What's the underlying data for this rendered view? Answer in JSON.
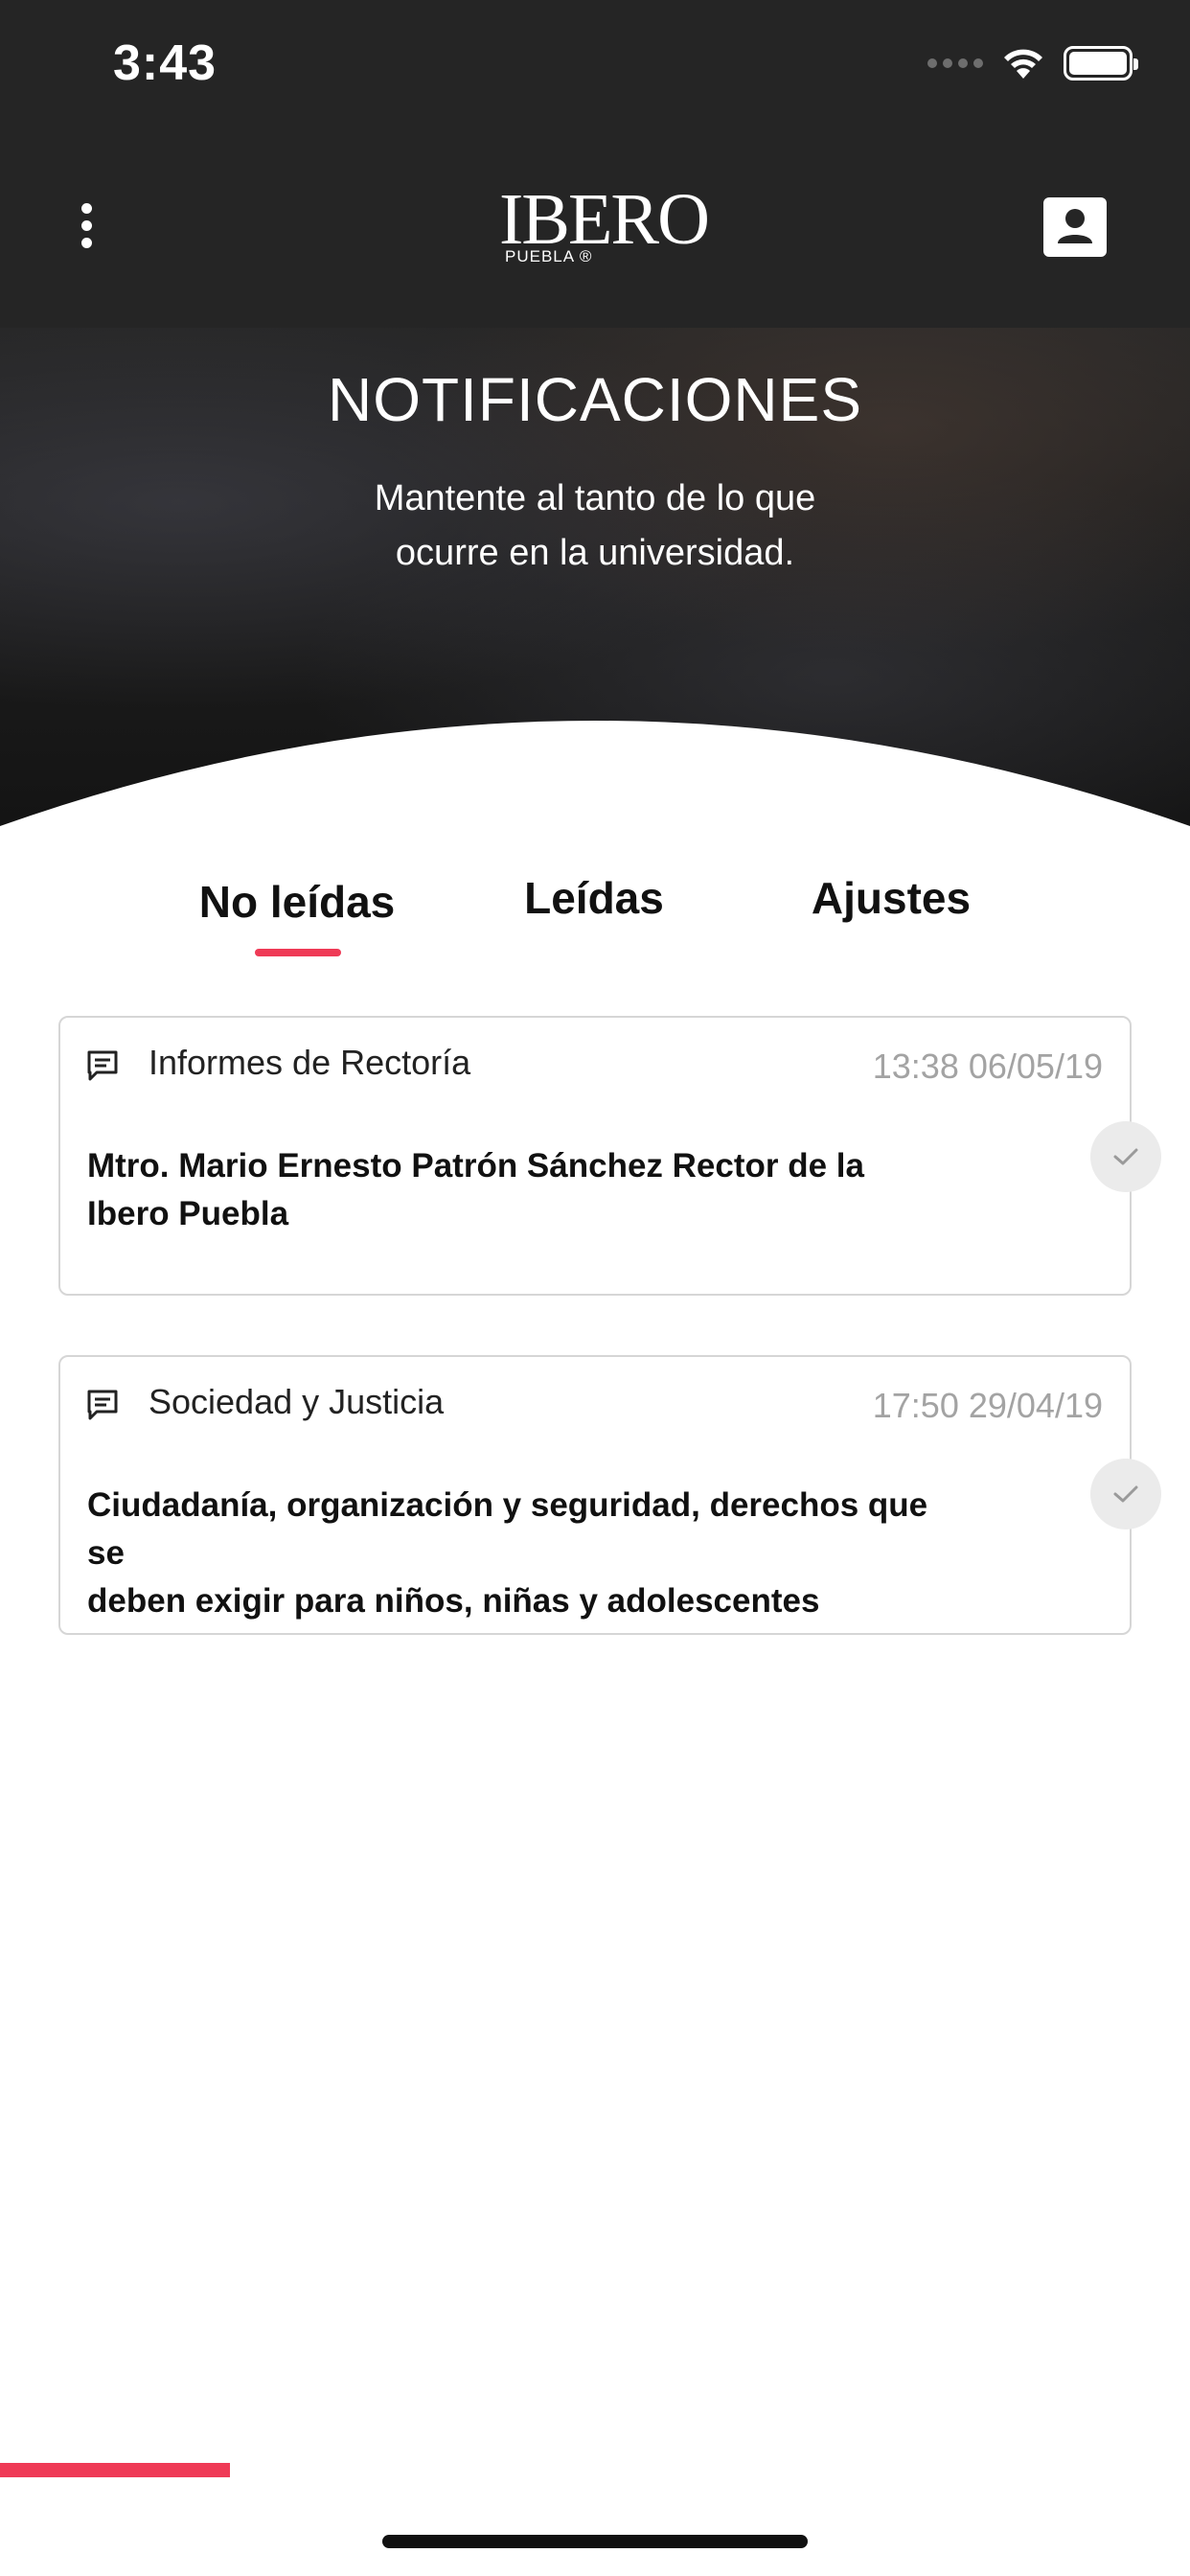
{
  "status_bar": {
    "time": "3:43",
    "icons": [
      "signal-dots-icon",
      "wifi-icon",
      "battery-icon"
    ]
  },
  "header": {
    "menu_icon": "vertical-ellipsis-icon",
    "logo": {
      "main": "IBERO",
      "sub": "PUEBLA ®"
    },
    "profile_icon": "user-profile-icon"
  },
  "hero": {
    "title": "NOTIFICACIONES",
    "subtitle_line1": "Mantente al tanto de lo que",
    "subtitle_line2": "ocurre en la universidad."
  },
  "tabs": [
    {
      "label": "No leídas",
      "selected": true
    },
    {
      "label": "Leídas",
      "selected": false
    },
    {
      "label": "Ajustes",
      "selected": false
    }
  ],
  "notifications": [
    {
      "icon": "message-icon",
      "category": "Informes de Rectoría",
      "timestamp": "13:38 06/05/19",
      "body_line1": "Mtro. Mario Ernesto Patrón Sánchez Rector de la",
      "body_line2": "Ibero Puebla",
      "action_icon": "checkmark-icon"
    },
    {
      "icon": "message-icon",
      "category": "Sociedad y Justicia",
      "timestamp": "17:50 29/04/19",
      "body_line1": "Ciudadanía, organización y seguridad, derechos que se",
      "body_line2": "deben exigir para niños, niñas y adolescentes",
      "action_icon": "checkmark-icon"
    }
  ],
  "colors": {
    "header_bg": "#252525",
    "accent": "#ef3a56",
    "card_border": "#d6d6d6",
    "timestamp": "#a3a3a3"
  }
}
